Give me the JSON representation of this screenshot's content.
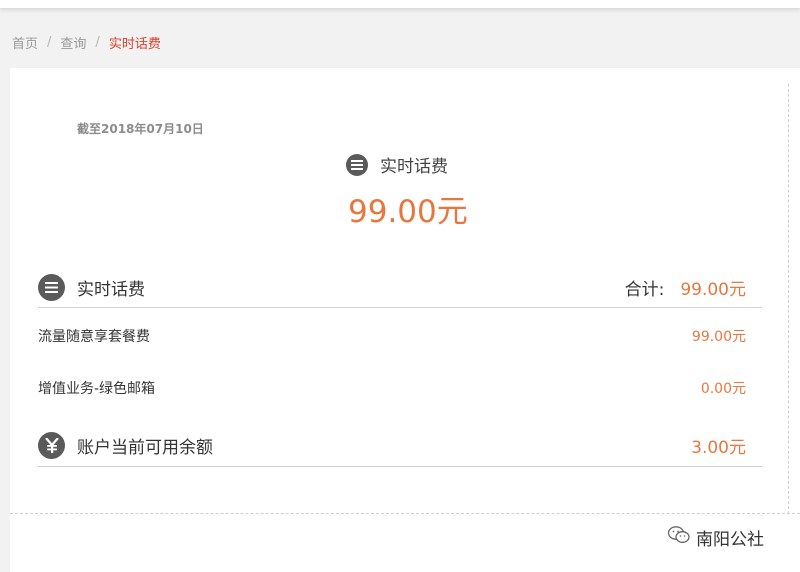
{
  "breadcrumb": {
    "items": [
      "首页",
      "查询"
    ],
    "current": "实时话费",
    "separator": "/"
  },
  "summary": {
    "as_of": "截至2018年07月10日",
    "title": "实时话费",
    "title_icon": "list-icon",
    "amount": "99.00元"
  },
  "details": {
    "header": {
      "label": "实时话费",
      "icon": "list-icon",
      "total_label": "合计:",
      "total_value": "99.00元"
    },
    "items": [
      {
        "label": "流量随意享套餐费",
        "amount": "99.00元"
      },
      {
        "label": "增值业务-绿色邮箱",
        "amount": "0.00元"
      }
    ],
    "balance": {
      "label": "账户当前可用余额",
      "icon": "yen-icon",
      "amount": "3.00元"
    }
  },
  "watermark": {
    "text": "南阳公社",
    "icon": "wechat-icon"
  },
  "colors": {
    "accent_orange": "#e8773f",
    "breadcrumb_active": "#e0402a",
    "icon_dark": "#5a5a5a"
  }
}
